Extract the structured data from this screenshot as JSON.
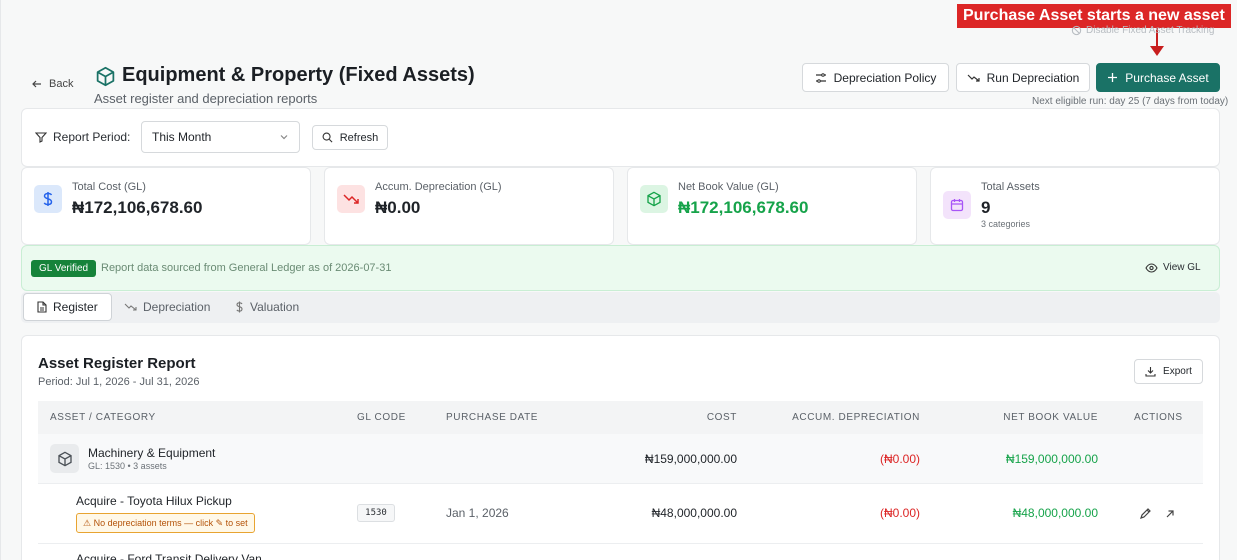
{
  "annotation": {
    "text": "Purchase Asset starts a new asset"
  },
  "header": {
    "disable_tracking": "Disable Fixed Asset Tracking",
    "back": "Back",
    "title": "Equipment & Property (Fixed Assets)",
    "subtitle": "Asset register and depreciation reports",
    "buttons": {
      "depreciation_policy": "Depreciation Policy",
      "run_depreciation": "Run Depreciation",
      "purchase_asset": "Purchase Asset"
    },
    "next_run": "Next eligible run: day 25 (7 days from today)"
  },
  "filters": {
    "report_period_label": "Report Period:",
    "period_value": "This Month",
    "refresh": "Refresh"
  },
  "stats": [
    {
      "label": "Total Cost (GL)",
      "value": "₦172,106,678.60",
      "icon": "dollar-icon",
      "color": "#1f2328"
    },
    {
      "label": "Accum. Depreciation (GL)",
      "value": "₦0.00",
      "icon": "trending-down-icon",
      "color": "#1f2328"
    },
    {
      "label": "Net Book Value (GL)",
      "value": "₦172,106,678.60",
      "icon": "box-icon",
      "color": "#16a34a"
    },
    {
      "label": "Total Assets",
      "value": "9",
      "sub": "3 categories",
      "icon": "calendar-icon",
      "color": "#1f2328"
    }
  ],
  "gl": {
    "badge": "GL Verified",
    "text": "Report data sourced from General Ledger as of 2026-07-31",
    "view": "View GL"
  },
  "tabs": [
    "Register",
    "Depreciation",
    "Valuation"
  ],
  "report": {
    "title": "Asset Register Report",
    "period": "Period: Jul 1, 2026 - Jul 31, 2026",
    "export": "Export",
    "columns": [
      "ASSET / CATEGORY",
      "GL CODE",
      "PURCHASE DATE",
      "COST",
      "ACCUM. DEPRECIATION",
      "NET BOOK VALUE",
      "ACTIONS"
    ],
    "category": {
      "name": "Machinery & Equipment",
      "sub": "GL: 1530 • 3 assets",
      "cost": "₦159,000,000.00",
      "accum": "(₦0.00)",
      "nbv": "₦159,000,000.00"
    },
    "asset": {
      "name": "Acquire - Toyota Hilux Pickup",
      "warning": "⚠ No depreciation terms — click ✎ to set",
      "gl_code": "1530",
      "date": "Jan 1, 2026",
      "cost": "₦48,000,000.00",
      "accum": "(₦0.00)",
      "nbv": "₦48,000,000.00"
    },
    "next_asset_name": "Acquire - Ford Transit Delivery Van"
  }
}
